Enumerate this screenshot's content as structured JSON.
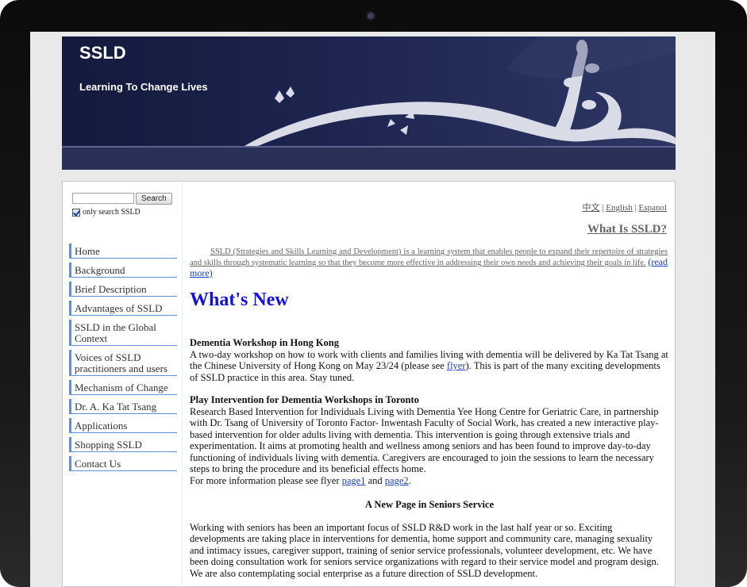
{
  "header": {
    "site_title": "SSLD",
    "tagline": "Learning To Change Lives"
  },
  "search": {
    "button_label": "Search",
    "checkbox_label": "only search SSLD",
    "checked": true
  },
  "nav": [
    "Home",
    "Background",
    "Brief Description",
    "Advantages of SSLD",
    "SSLD in the Global Context",
    "Voices of SSLD practitioners and users",
    "Mechanism of Change",
    "Dr. A. Ka Tat Tsang",
    "Applications",
    "Shopping SSLD",
    "Contact Us"
  ],
  "lang": {
    "chinese": "中文",
    "english": "English",
    "spanish": "Espanol",
    "sep": " | "
  },
  "what_is": {
    "heading": "What Is SSLD?",
    "body": "SSLD (Strategies and Skills Learning and Development) is a learning system that enables people to expand their repertoire of strategies and skills through systematic learning so that they become more effective in addressing their own needs and achieving their goals in life.",
    "read_more": "(read more)"
  },
  "whats_new": "What's New",
  "news": {
    "item1": {
      "title": "Dementia Workshop in Hong Kong",
      "text_a": "A two-day workshop on how to work with clients and families living with dementia will be delivered by Ka Tat Tsang at the Chinese University of Hong Kong on May 23/24 (please see ",
      "link": "flyer",
      "text_b": "). This is part of the many exciting developments of SSLD practice in this area. Stay tuned."
    },
    "item2": {
      "title": "Play Intervention for Dementia Workshops in Toronto",
      "text": "Research Based Intervention for Individuals Living with Dementia Yee Hong Centre for Geriatric Care, in partnership with Dr. Tsang of University of Toronto Factor- Inwentash Faculty of Social Work, has created a new interactive play-based intervention for older adults living with dementia. This intervention is going through extensive trials and experimentation. It aims at promoting health and wellness among seniors and has been found to improve day-to-day functioning of individuals living with dementia. Caregivers are encouraged to join the sessions to learn the necessary steps to bring the procedure and its beneficial effects home.",
      "more_prefix": "For more information please see flyer ",
      "page1": "page1",
      "and": " and ",
      "page2": "page2",
      "period": "."
    },
    "item3": {
      "title": "A New Page in Seniors Service",
      "text": "Working with seniors has been an important focus of SSLD R&D work in the last half year or so. Exciting developments are taking place in interventions for dementia, home support and community care, managing sexuality and intimacy issues, caregiver support, training of senior service professionals, volunteer development, etc. We have been doing consultation work for seniors service organizations with regard to their service model and program design. We are also contemplating social enterprise as a future direction of SSLD development."
    }
  }
}
